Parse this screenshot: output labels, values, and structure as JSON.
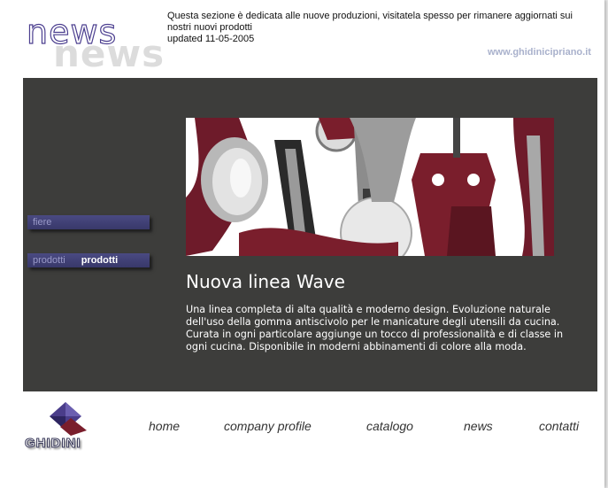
{
  "header": {
    "news_word": "news",
    "news_shadow_word": "news",
    "intro_text": "Questa sezione è dedicata alle nuove produzioni, visitatela spesso per rimanere aggiornati sui nostri nuovi prodotti",
    "updated": "updated 11-05-2005",
    "site_url": "www.ghidinicipriano.it"
  },
  "sidebar": {
    "fiere_label": "fiere",
    "prodotti_label": "prodotti",
    "prodotti_active_label": "prodotti"
  },
  "main": {
    "image_subject": "kitchen-utensils-wave-line",
    "headline": "Nuova linea Wave",
    "description": "Una linea completa di alta qualità e moderno design. Evoluzione naturale dell'uso della gomma antiscivolo per le manicature degli utensili da cucina. Curata in ogni particolare aggiunge un tocco di professionalità e di classe in ogni cucina. Disponibile in moderni abbinamenti di colore alla moda."
  },
  "footer": {
    "brand": "GHIDINI",
    "nav": [
      "home",
      "company profile",
      "catalogo",
      "news",
      "contatti"
    ]
  },
  "colors": {
    "dark_panel": "#3d3d3b",
    "menu_button": "#42427a",
    "accent_purple": "#4b3e8f",
    "utensil_red": "#7a1e2c"
  }
}
